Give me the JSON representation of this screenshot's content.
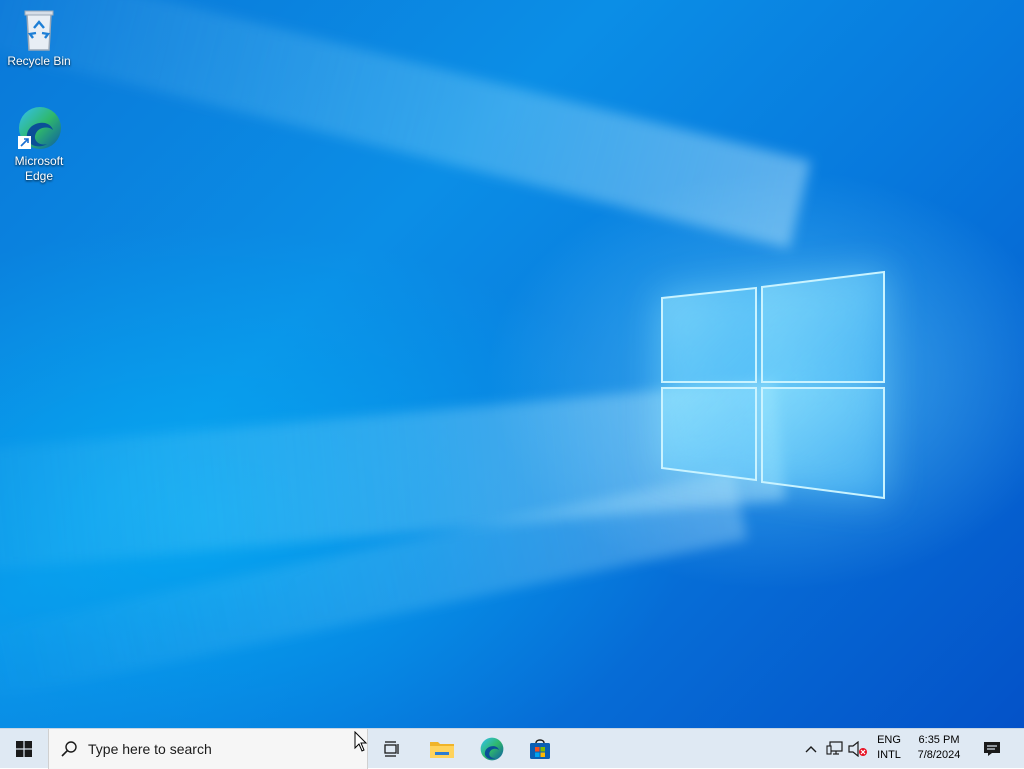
{
  "desktop": {
    "icons": [
      {
        "label": "Recycle Bin",
        "icon": "recycle-bin-icon"
      },
      {
        "label": "Microsoft\nEdge",
        "icon": "edge-icon"
      }
    ],
    "wallpaper": {
      "primary": "#0a78d8",
      "glow": "#7fdcff"
    }
  },
  "taskbar": {
    "start_icon": "windows-logo-icon",
    "search": {
      "placeholder": "Type here to search",
      "icon": "search-icon"
    },
    "pinned": [
      {
        "name": "Task View",
        "icon": "task-view-icon"
      },
      {
        "name": "File Explorer",
        "icon": "folder-icon"
      },
      {
        "name": "Microsoft Edge",
        "icon": "edge-icon"
      },
      {
        "name": "Microsoft Store",
        "icon": "store-icon"
      }
    ],
    "tray": {
      "chevron_icon": "chevron-up-icon",
      "network_icon": "network-icon",
      "volume_icon": "volume-muted-icon",
      "language_line1": "ENG",
      "language_line2": "INTL",
      "time": "6:35 PM",
      "date": "7/8/2024",
      "notification_icon": "action-center-icon"
    },
    "background": "#dfe9f3"
  }
}
